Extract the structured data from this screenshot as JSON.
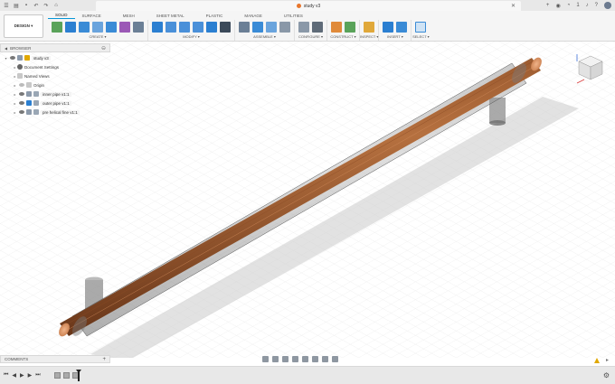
{
  "topbar": {
    "document_title": "study v3",
    "notification_count": "1"
  },
  "toolbar": {
    "workspace_label": "DESIGN ▾",
    "tabs": [
      "SOLID",
      "SURFACE",
      "MESH",
      "SHEET METAL",
      "PLASTIC",
      "MANAGE",
      "UTILITIES"
    ],
    "groups": [
      {
        "label": "CREATE ▾"
      },
      {
        "label": "MODIFY ▾"
      },
      {
        "label": "ASSEMBLE ▾"
      },
      {
        "label": "CONFIGURE ▾"
      },
      {
        "label": "CONSTRUCT ▾"
      },
      {
        "label": "INSPECT ▾"
      },
      {
        "label": "INSERT ▾"
      },
      {
        "label": "SELECT ▾"
      }
    ]
  },
  "browser": {
    "title": "BROWSER",
    "items": [
      {
        "label": "study v3"
      },
      {
        "label": "Document Settings"
      },
      {
        "label": "Named Views"
      },
      {
        "label": "Origin"
      },
      {
        "label": "inner pipe v1:1"
      },
      {
        "label": "outer pipe v1:1"
      },
      {
        "label": "pre helical fine v1:1"
      }
    ]
  },
  "comments": {
    "title": "COMMENTS"
  },
  "colors": {
    "accent": "#0696d7",
    "copper": "#b5703f",
    "glass": "#7f7f7f"
  }
}
